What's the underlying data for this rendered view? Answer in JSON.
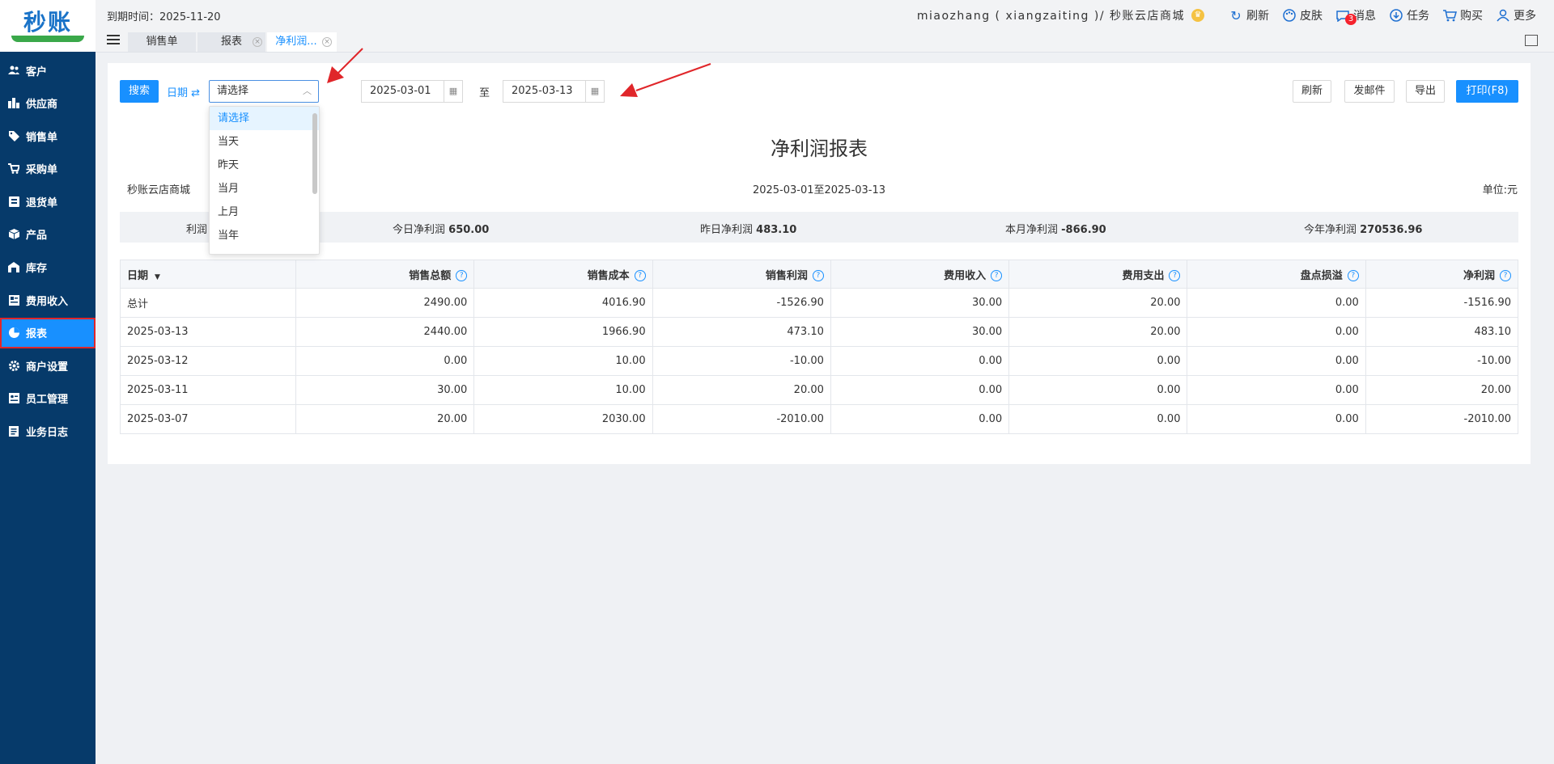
{
  "app": {
    "logo_text": "秒账"
  },
  "header": {
    "expire_text": "到期时间：2025-11-20",
    "user_text": "miaozhang ( xiangzaiting )/ 秒账云店商城",
    "nav": [
      {
        "label": "刷新",
        "icon": "refresh-icon"
      },
      {
        "label": "皮肤",
        "icon": "palette-icon"
      },
      {
        "label": "消息",
        "icon": "message-icon",
        "badge": "3"
      },
      {
        "label": "任务",
        "icon": "download-icon"
      },
      {
        "label": "购买",
        "icon": "cart-icon"
      },
      {
        "label": "更多",
        "icon": "user-icon"
      }
    ]
  },
  "tabs": [
    {
      "label": "销售单"
    },
    {
      "label": "报表"
    },
    {
      "label": "净利润..."
    }
  ],
  "sidebar": {
    "items": [
      {
        "label": "客户",
        "icon": "users-icon"
      },
      {
        "label": "供应商",
        "icon": "supplier-icon"
      },
      {
        "label": "销售单",
        "icon": "tag-icon"
      },
      {
        "label": "采购单",
        "icon": "cart-icon"
      },
      {
        "label": "退货单",
        "icon": "return-icon"
      },
      {
        "label": "产品",
        "icon": "box-icon"
      },
      {
        "label": "库存",
        "icon": "warehouse-icon"
      },
      {
        "label": "费用收入",
        "icon": "ledger-icon"
      },
      {
        "label": "报表",
        "icon": "pie-chart-icon",
        "active": true
      },
      {
        "label": "商户设置",
        "icon": "gear-icon"
      },
      {
        "label": "员工管理",
        "icon": "staff-icon"
      },
      {
        "label": "业务日志",
        "icon": "log-icon"
      }
    ]
  },
  "toolbar": {
    "search_label": "搜索",
    "date_label": "日期",
    "select_value": "请选择",
    "start_date": "2025-03-01",
    "to_label": "至",
    "end_date": "2025-03-13",
    "refresh_label": "刷新",
    "mail_label": "发邮件",
    "export_label": "导出",
    "print_label": "打印(F8)"
  },
  "dropdown": {
    "options": [
      "请选择",
      "当天",
      "昨天",
      "当月",
      "上月",
      "当年"
    ]
  },
  "report": {
    "title": "净利润报表",
    "shop": "秒账云店商城",
    "period": "2025-03-01至2025-03-13",
    "unit": "单位:元",
    "summary_label": "利润",
    "summary": [
      {
        "label": "今日净利润",
        "value": "650.00"
      },
      {
        "label": "昨日净利润",
        "value": "483.10"
      },
      {
        "label": "本月净利润",
        "value": "-866.90"
      },
      {
        "label": "今年净利润",
        "value": "270536.96"
      }
    ]
  },
  "table": {
    "headers": [
      "日期",
      "销售总额",
      "销售成本",
      "销售利润",
      "费用收入",
      "费用支出",
      "盘点损溢",
      "净利润"
    ],
    "rows": [
      [
        "总计",
        "2490.00",
        "4016.90",
        "-1526.90",
        "30.00",
        "20.00",
        "0.00",
        "-1516.90"
      ],
      [
        "2025-03-13",
        "2440.00",
        "1966.90",
        "473.10",
        "30.00",
        "20.00",
        "0.00",
        "483.10"
      ],
      [
        "2025-03-12",
        "0.00",
        "10.00",
        "-10.00",
        "0.00",
        "0.00",
        "0.00",
        "-10.00"
      ],
      [
        "2025-03-11",
        "30.00",
        "10.00",
        "20.00",
        "0.00",
        "0.00",
        "0.00",
        "20.00"
      ],
      [
        "2025-03-07",
        "20.00",
        "2030.00",
        "-2010.00",
        "0.00",
        "0.00",
        "0.00",
        "-2010.00"
      ]
    ]
  },
  "colors": {
    "sidebar": "#063a6a",
    "accent": "#1890ff",
    "annotation": "#e0262a"
  }
}
